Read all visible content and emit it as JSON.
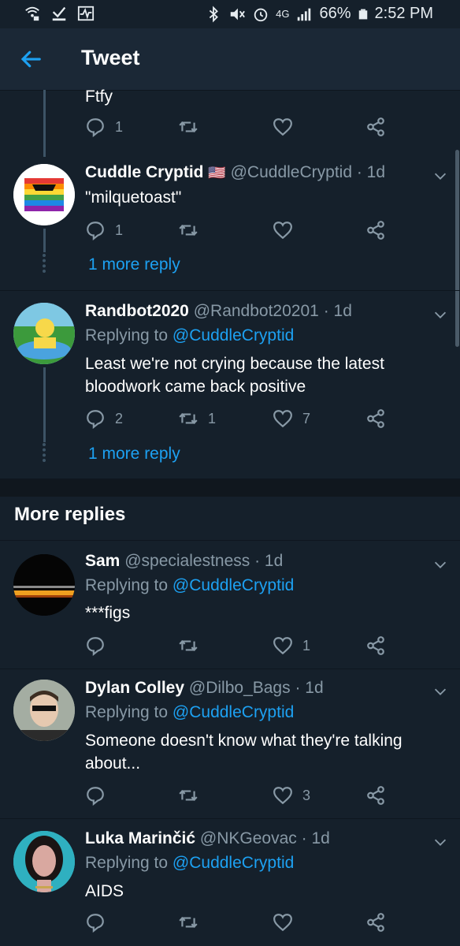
{
  "status_bar": {
    "battery": "66%",
    "time": "2:52 PM",
    "network": "4G"
  },
  "header": {
    "title": "Tweet"
  },
  "top_fragment": {
    "text": "Ftfy",
    "reply_count": "1"
  },
  "tweets": [
    {
      "name": "Cuddle Cryptid",
      "flag": "🇺🇸",
      "handle": "@CuddleCryptid",
      "age": "· 1d",
      "text": "\"milquetoast\"",
      "reply_count": "1",
      "more_reply": "1 more reply"
    },
    {
      "name": "Randbot2020",
      "handle": "@Randbot20201",
      "age": "· 1d",
      "replying_prefix": "Replying to",
      "replying_to": "@CuddleCryptid",
      "text": "Least we're not crying because the latest bloodwork came back positive",
      "reply_count": "2",
      "retweet_count": "1",
      "like_count": "7",
      "more_reply": "1 more reply"
    }
  ],
  "more_replies": {
    "title": "More replies"
  },
  "replies": [
    {
      "name": "Sam",
      "handle": "@specialestness",
      "age": "· 1d",
      "replying_prefix": "Replying to",
      "replying_to": "@CuddleCryptid",
      "text": "***figs",
      "like_count": "1"
    },
    {
      "name": "Dylan Colley",
      "handle": "@Dilbo_Bags",
      "age": "· 1d",
      "replying_prefix": "Replying to",
      "replying_to": "@CuddleCryptid",
      "text": "Someone doesn't know what they're talking about...",
      "like_count": "3"
    },
    {
      "name": "Luka Marinčić",
      "handle": "@NKGeovac",
      "age": "· 1d",
      "replying_prefix": "Replying to",
      "replying_to": "@CuddleCryptid",
      "text": "AIDS"
    }
  ],
  "colors": {
    "background": "#15202b",
    "accent": "#1da1f2",
    "muted": "#8899a6"
  }
}
